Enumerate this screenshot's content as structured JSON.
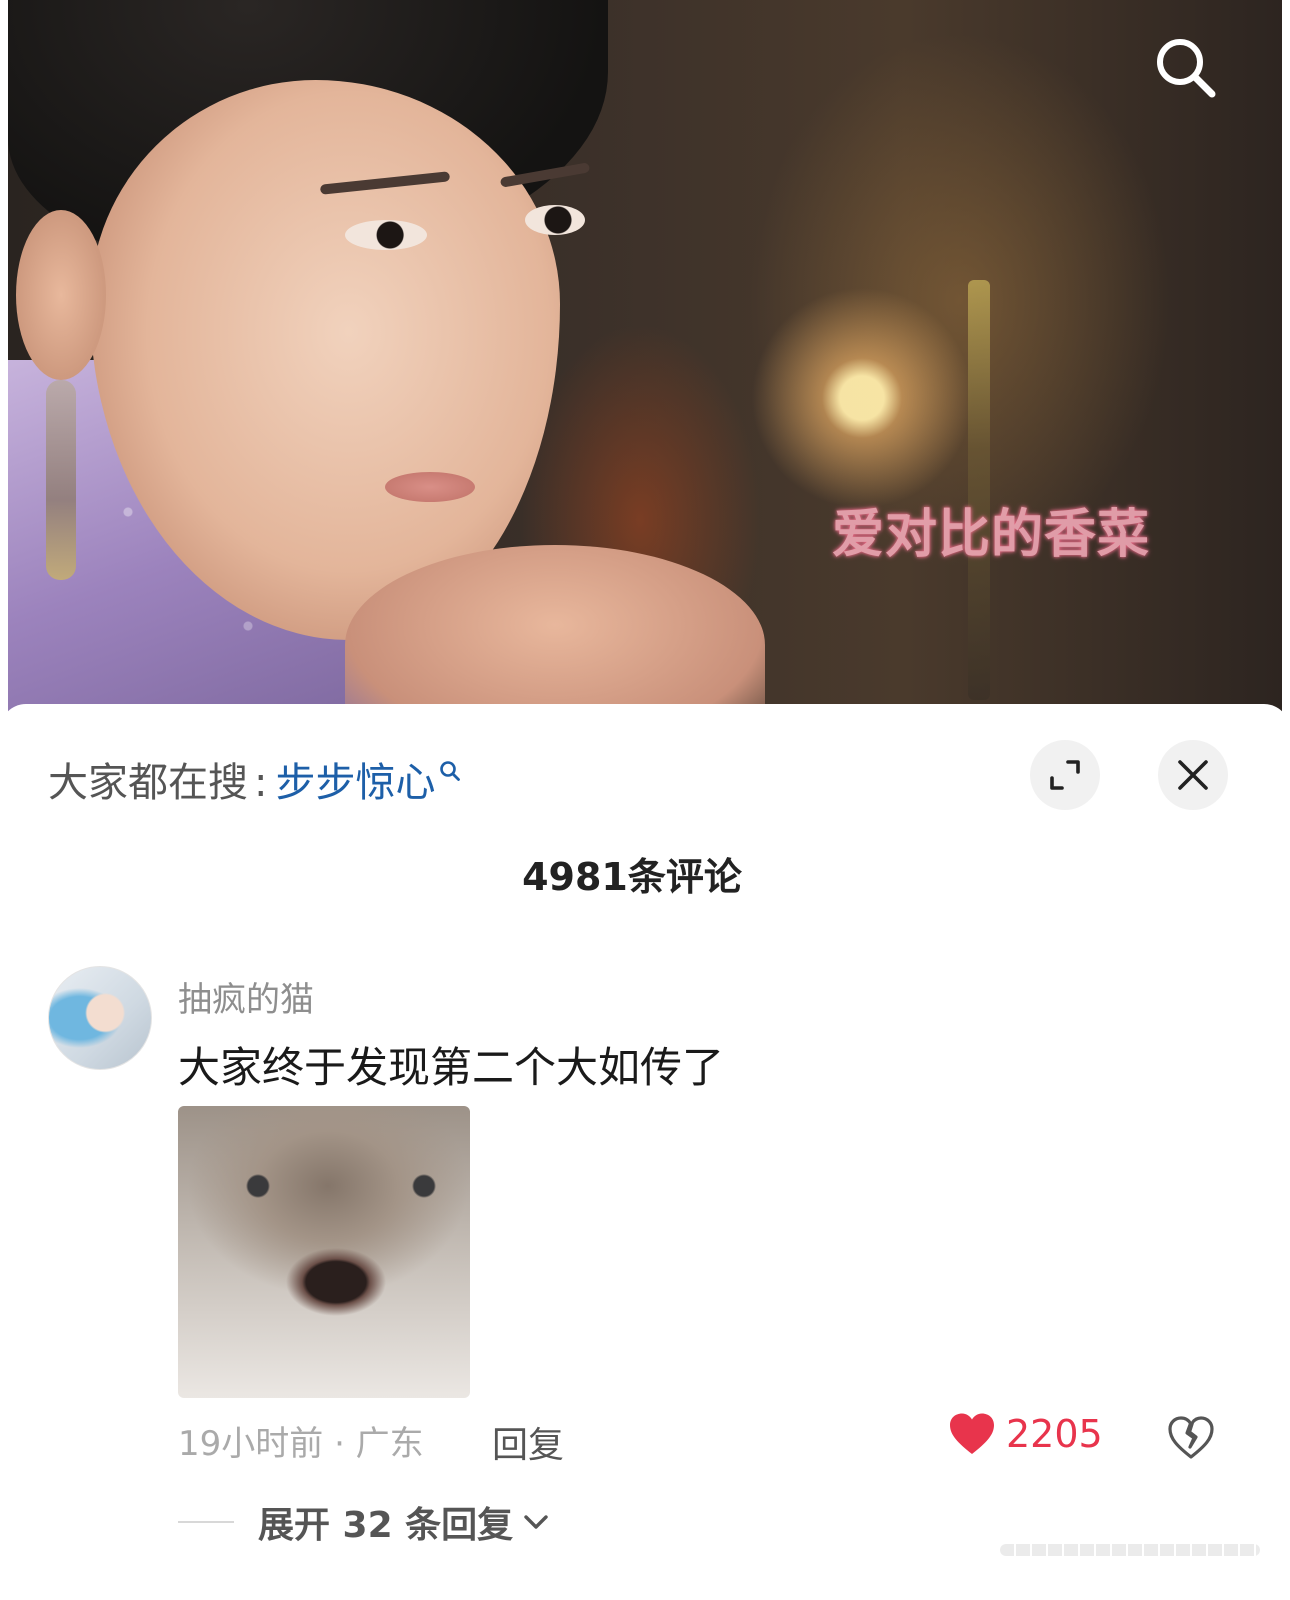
{
  "video": {
    "watermark": "爱对比的香菜",
    "search_icon": "search-icon"
  },
  "sheet": {
    "hot_search_prefix": "大家都在搜",
    "hot_search_sep": ":",
    "hot_search_keyword": "步步惊心",
    "expand_icon": "expand-icon",
    "close_icon": "close-icon",
    "comment_count_title": "4981条评论"
  },
  "comment": {
    "username": "抽疯的猫",
    "text": "大家终于发现第二个大如传了",
    "time_location": "19小时前 · 广东",
    "reply_label": "回复",
    "likes": "2205",
    "like_color": "#e8344c",
    "expand_replies_label": "展开 32 条回复"
  },
  "colors": {
    "link_blue": "#1d5fa8",
    "like_red": "#e8344c"
  }
}
